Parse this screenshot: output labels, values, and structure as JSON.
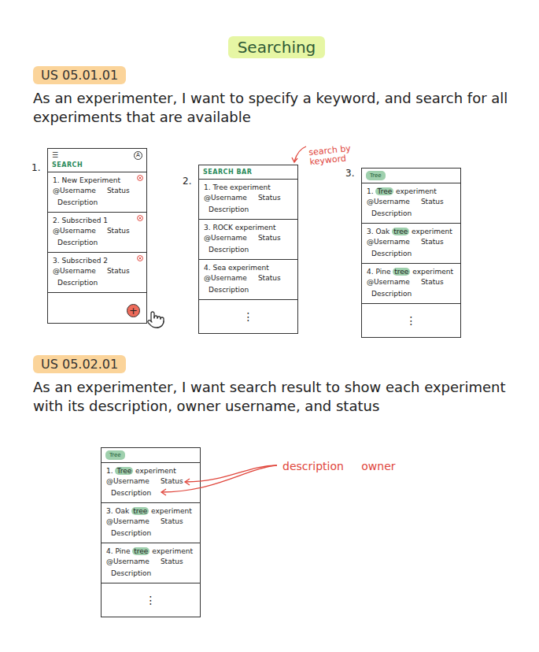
{
  "title": "Searching",
  "stories": [
    {
      "label": "US 05.01.01",
      "text": "As an experimenter, I want to specify a keyword, and search for all experiments that are available",
      "screens": [
        {
          "number": "1.",
          "kind": "home",
          "menu": "☰",
          "avatar": "A",
          "header": "SEARCH",
          "fab": "+",
          "items": [
            {
              "title": [
                {
                  "text": "1. New Experiment",
                  "highlighted": false
                }
              ],
              "username": "@Username",
              "status": "Status",
              "description": "Description",
              "deletable": true
            },
            {
              "title": [
                {
                  "text": "2. Subscribed 1",
                  "highlighted": false
                }
              ],
              "username": "@Username",
              "status": "Status",
              "description": "Description",
              "deletable": true
            },
            {
              "title": [
                {
                  "text": "3. Subscribed 2",
                  "highlighted": false
                }
              ],
              "username": "@Username",
              "status": "Status",
              "description": "Description",
              "deletable": true
            }
          ]
        },
        {
          "number": "2.",
          "kind": "search",
          "header": "SEARCH BAR",
          "annotation": "search by keyword",
          "more": "⋮",
          "items": [
            {
              "title": [
                {
                  "text": "1. Tree experiment",
                  "highlighted": false
                }
              ],
              "username": "@Username",
              "status": "Status",
              "description": "Description",
              "deletable": false
            },
            {
              "title": [
                {
                  "text": "3. ROCK experiment",
                  "highlighted": false
                }
              ],
              "username": "@Username",
              "status": "Status",
              "description": "Description",
              "deletable": false
            },
            {
              "title": [
                {
                  "text": "4. Sea experiment",
                  "highlighted": false
                }
              ],
              "username": "@Username",
              "status": "Status",
              "description": "Description",
              "deletable": false
            }
          ]
        },
        {
          "number": "3.",
          "kind": "results",
          "query": "Tree",
          "more": "⋮",
          "items": [
            {
              "title": [
                {
                  "text": "1. ",
                  "highlighted": false
                },
                {
                  "text": "Tree",
                  "highlighted": true
                },
                {
                  "text": " experiment",
                  "highlighted": false
                }
              ],
              "username": "@Username",
              "status": "Status",
              "description": "Description",
              "deletable": false
            },
            {
              "title": [
                {
                  "text": "3. Oak ",
                  "highlighted": false
                },
                {
                  "text": "tree",
                  "highlighted": true
                },
                {
                  "text": " experiment",
                  "highlighted": false
                }
              ],
              "username": "@Username",
              "status": "Status",
              "description": "Description",
              "deletable": false
            },
            {
              "title": [
                {
                  "text": "4. Pine ",
                  "highlighted": false
                },
                {
                  "text": "tree",
                  "highlighted": true
                },
                {
                  "text": " experiment",
                  "highlighted": false
                }
              ],
              "username": "@Username",
              "status": "Status",
              "description": "Description",
              "deletable": false
            }
          ]
        }
      ]
    },
    {
      "label": "US 05.02.01",
      "text": "As an experimenter, I want search result to show each experiment with its description, owner username, and status",
      "screens": [
        {
          "number": "",
          "kind": "results",
          "query": "Tree",
          "more": "⋮",
          "callout": "description owner",
          "items": [
            {
              "title": [
                {
                  "text": "1. ",
                  "highlighted": false
                },
                {
                  "text": "Tree",
                  "highlighted": true
                },
                {
                  "text": " experiment",
                  "highlighted": false
                }
              ],
              "username": "@Username",
              "status": "Status",
              "description": "Description",
              "deletable": false
            },
            {
              "title": [
                {
                  "text": "3. Oak ",
                  "highlighted": false
                },
                {
                  "text": "tree",
                  "highlighted": true
                },
                {
                  "text": " experiment",
                  "highlighted": false
                }
              ],
              "username": "@Username",
              "status": "Status",
              "description": "Description",
              "deletable": false
            },
            {
              "title": [
                {
                  "text": "4. Pine ",
                  "highlighted": false
                },
                {
                  "text": "tree",
                  "highlighted": true
                },
                {
                  "text": " experiment",
                  "highlighted": false
                }
              ],
              "username": "@Username",
              "status": "Status",
              "description": "Description",
              "deletable": false
            }
          ]
        }
      ]
    }
  ]
}
